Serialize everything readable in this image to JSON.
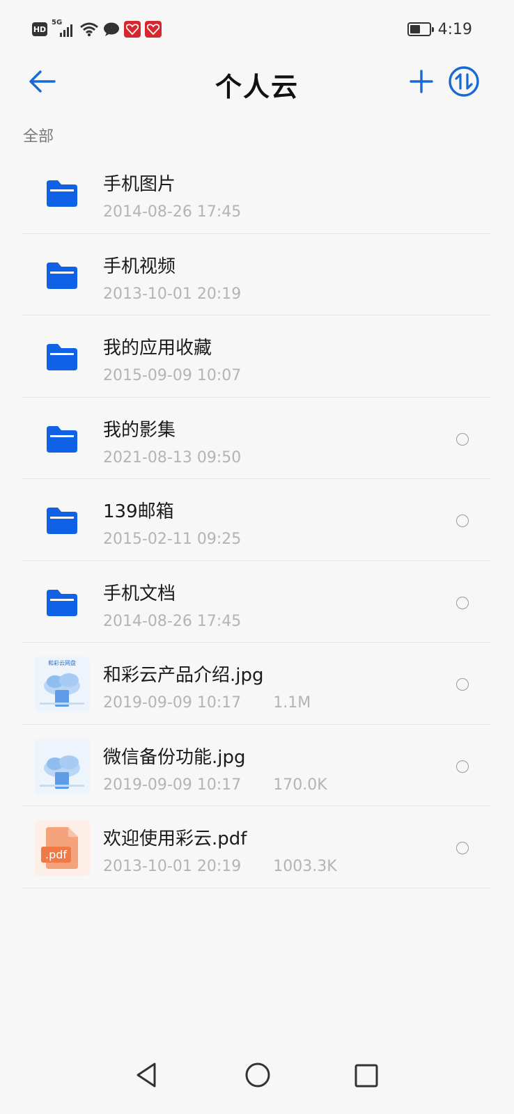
{
  "status_bar": {
    "network_badge": "HD",
    "signal_label": "5G",
    "time": "4:19",
    "battery_level": 0.55,
    "icons": [
      "hd-icon",
      "signal-5g-icon",
      "wifi-icon",
      "message-icon",
      "app-badge-icon",
      "app-badge-icon",
      "battery-icon"
    ]
  },
  "app_bar": {
    "title": "个人云",
    "back_icon": "arrow-left-icon",
    "add_icon": "plus-icon",
    "sort_icon": "transfer-icon"
  },
  "breadcrumb": "全部",
  "colors": {
    "accent": "#1769d6",
    "folder": "#0f62e6",
    "secondary_text": "#b4b4b4",
    "pdf": "#f07a45"
  },
  "files": [
    {
      "type": "folder",
      "name": "手机图片",
      "date": "2014-08-26 17:45",
      "size": "",
      "selectable": false
    },
    {
      "type": "folder",
      "name": "手机视频",
      "date": "2013-10-01 20:19",
      "size": "",
      "selectable": false
    },
    {
      "type": "folder",
      "name": "我的应用收藏",
      "date": "2015-09-09 10:07",
      "size": "",
      "selectable": false
    },
    {
      "type": "folder",
      "name": "我的影集",
      "date": "2021-08-13 09:50",
      "size": "",
      "selectable": true
    },
    {
      "type": "folder",
      "name": "139邮箱",
      "date": "2015-02-11 09:25",
      "size": "",
      "selectable": true
    },
    {
      "type": "folder",
      "name": "手机文档",
      "date": "2014-08-26 17:45",
      "size": "",
      "selectable": true
    },
    {
      "type": "image",
      "name": "和彩云产品介绍.jpg",
      "date": "2019-09-09 10:17",
      "size": "1.1M",
      "selectable": true,
      "thumb_caption": "和彩云网盘"
    },
    {
      "type": "image",
      "name": "微信备份功能.jpg",
      "date": "2019-09-09 10:17",
      "size": "170.0K",
      "selectable": true
    },
    {
      "type": "pdf",
      "name": "欢迎使用彩云.pdf",
      "date": "2013-10-01 20:19",
      "size": "1003.3K",
      "selectable": true,
      "thumb_label": ".pdf"
    }
  ],
  "nav_bar": {
    "icons": [
      "nav-back-icon",
      "nav-home-icon",
      "nav-recents-icon"
    ]
  }
}
